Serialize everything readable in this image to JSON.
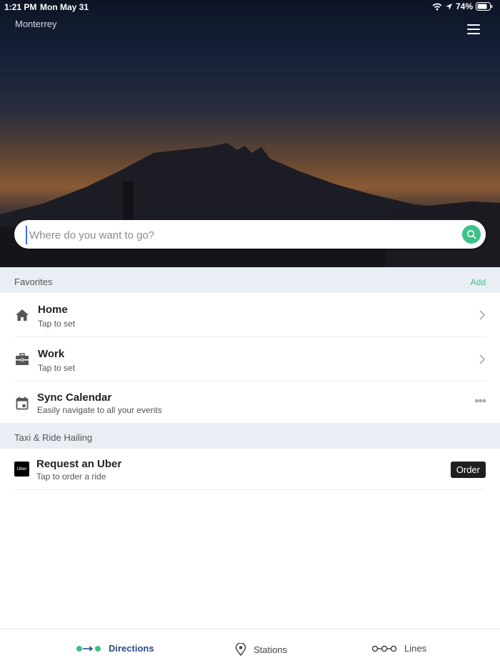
{
  "status_bar": {
    "time": "1:21 PM",
    "date": "Mon May 31",
    "battery": "74%"
  },
  "header": {
    "city": "Monterrey"
  },
  "search": {
    "placeholder": "Where do you want to go?",
    "value": ""
  },
  "favorites": {
    "title": "Favorites",
    "add_label": "Add",
    "items": [
      {
        "label": "Home",
        "sub": "Tap to set",
        "icon": "home-icon"
      },
      {
        "label": "Work",
        "sub": "Tap to set",
        "icon": "briefcase-icon"
      },
      {
        "label": "Sync Calendar",
        "sub": "Easily navigate to all your events",
        "icon": "calendar-icon"
      }
    ]
  },
  "taxi": {
    "title": "Taxi & Ride Hailing",
    "item": {
      "logo": "Uber",
      "label": "Request an Uber",
      "sub": "Tap to order a ride",
      "button": "Order"
    }
  },
  "tabbar": {
    "tabs": [
      {
        "label": "Directions",
        "icon": "directions-icon",
        "active": true
      },
      {
        "label": "Stations",
        "icon": "location-pin-icon",
        "active": false
      },
      {
        "label": "Lines",
        "icon": "lines-icon",
        "active": false
      }
    ]
  },
  "colors": {
    "accent": "#3ec08b",
    "active_tab": "#2c4a8c",
    "section_bg": "#e9eef5"
  }
}
